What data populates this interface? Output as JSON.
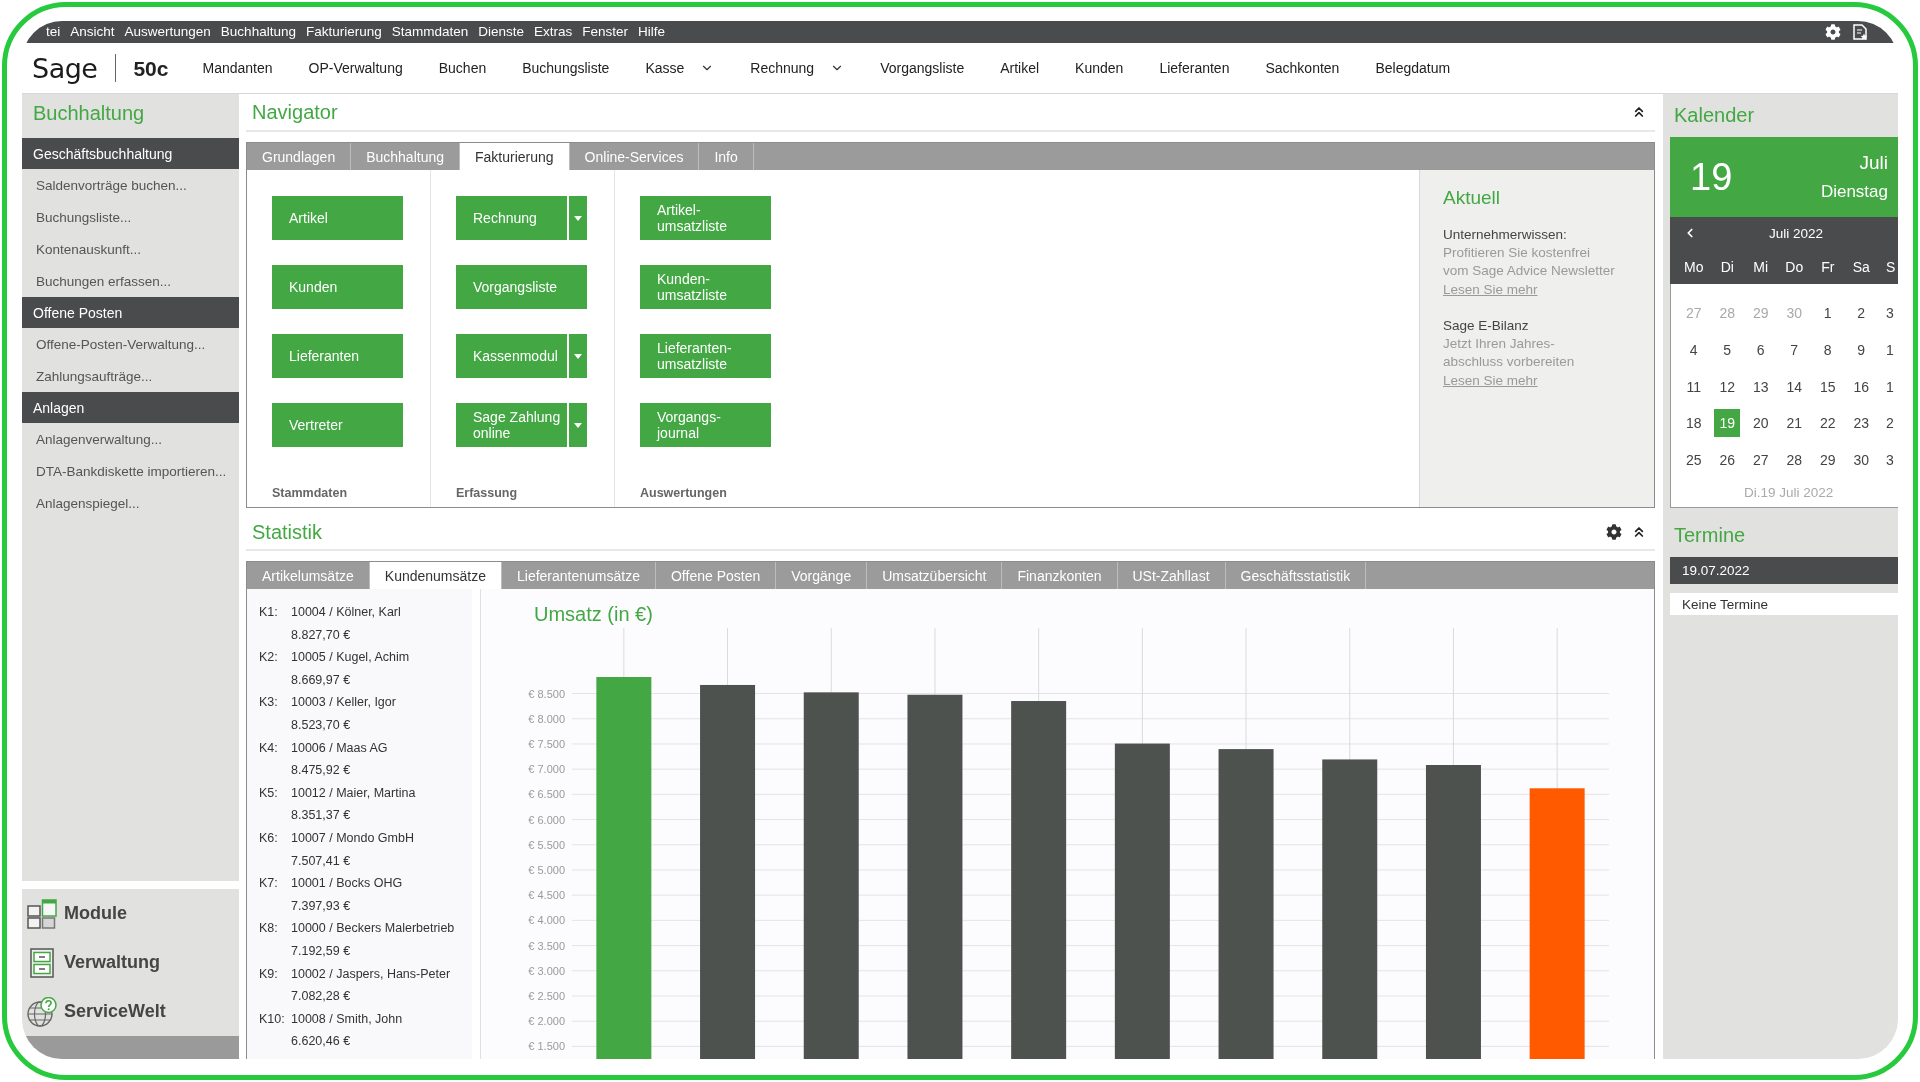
{
  "menu_bar": {
    "items": [
      "tei",
      "Ansicht",
      "Auswertungen",
      "Buchhaltung",
      "Fakturierung",
      "Stammdaten",
      "Dienste",
      "Extras",
      "Fenster",
      "Hilfe"
    ]
  },
  "toolbar": {
    "logo": "Sage",
    "edition": "50c",
    "items": [
      {
        "label": "Mandanten",
        "dropdown": false
      },
      {
        "label": "OP-Verwaltung",
        "dropdown": false
      },
      {
        "label": "Buchen",
        "dropdown": false
      },
      {
        "label": "Buchungsliste",
        "dropdown": false
      },
      {
        "label": "Kasse",
        "dropdown": true
      },
      {
        "label": "Rechnung",
        "dropdown": true
      },
      {
        "label": "Vorgangsliste",
        "dropdown": false
      },
      {
        "label": "Artikel",
        "dropdown": false
      },
      {
        "label": "Kunden",
        "dropdown": false
      },
      {
        "label": "Lieferanten",
        "dropdown": false
      },
      {
        "label": "Sachkonten",
        "dropdown": false
      },
      {
        "label": "Belegdatum",
        "dropdown": false
      }
    ]
  },
  "sidebar": {
    "title": "Buchhaltung",
    "groups": [
      {
        "label": "Geschäftsbuchhaltung",
        "items": [
          "Saldenvorträge buchen...",
          "Buchungsliste...",
          "Kontenauskunft...",
          "Buchungen erfassen..."
        ]
      },
      {
        "label": "Offene Posten",
        "items": [
          "Offene-Posten-Verwaltung...",
          "Zahlungsaufträge..."
        ]
      },
      {
        "label": "Anlagen",
        "items": [
          "Anlagenverwaltung...",
          "DTA-Bankdiskette importieren...",
          "Anlagenspiegel..."
        ]
      }
    ],
    "shortcuts": [
      {
        "label": "Module",
        "kind": "modules"
      },
      {
        "label": "Verwaltung",
        "kind": "administration"
      },
      {
        "label": "ServiceWelt",
        "kind": "service"
      }
    ]
  },
  "navigator": {
    "title": "Navigator",
    "tabs": [
      {
        "label": "Grundlagen",
        "selected": false
      },
      {
        "label": "Buchhaltung",
        "selected": false
      },
      {
        "label": "Fakturierung",
        "selected": true
      },
      {
        "label": "Online-Services",
        "selected": false
      },
      {
        "label": "Info",
        "selected": false
      }
    ],
    "columns": [
      {
        "label": "Stammdaten",
        "buttons": [
          {
            "label": "Artikel",
            "split": false
          },
          {
            "label": "Kunden",
            "split": false
          },
          {
            "label": "Lieferanten",
            "split": false
          },
          {
            "label": "Vertreter",
            "split": false
          }
        ]
      },
      {
        "label": "Erfassung",
        "buttons": [
          {
            "label": "Rechnung",
            "split": true
          },
          {
            "label": "Vorgangsliste",
            "split": false
          },
          {
            "label": "Kassenmodul",
            "split": true
          },
          {
            "label": "Sage Zahlung\nonline",
            "split": true
          }
        ]
      },
      {
        "label": "Auswertungen",
        "buttons": [
          {
            "label": "Artikel-\numsatzliste",
            "split": false
          },
          {
            "label": "Kunden-\numsatzliste",
            "split": false
          },
          {
            "label": "Lieferanten-\numsatzliste",
            "split": false
          },
          {
            "label": "Vorgangs-\njournal",
            "split": false
          }
        ]
      }
    ],
    "news": {
      "title": "Aktuell",
      "items": [
        {
          "heading": "Unternehmerwissen:",
          "text": "Profitieren Sie kostenfrei\nvom Sage Advice Newsletter",
          "link": "Lesen Sie mehr"
        },
        {
          "heading": "Sage E-Bilanz",
          "text": "Jetzt Ihren Jahres-\nabschluss vorbereiten",
          "link": "Lesen Sie mehr"
        }
      ]
    }
  },
  "statistik": {
    "title": "Statistik",
    "tabs": [
      {
        "label": "Artikelumsätze",
        "selected": false
      },
      {
        "label": "Kundenumsätze",
        "selected": true
      },
      {
        "label": "Lieferantenumsätze",
        "selected": false
      },
      {
        "label": "Offene Posten",
        "selected": false
      },
      {
        "label": "Vorgänge",
        "selected": false
      },
      {
        "label": "Umsatzübersicht",
        "selected": false
      },
      {
        "label": "Finanzkonten",
        "selected": false
      },
      {
        "label": "USt-Zahllast",
        "selected": false
      },
      {
        "label": "Geschäftsstatistik",
        "selected": false
      }
    ],
    "customers": [
      {
        "rank": "K1:",
        "name": "10004 / Kölner, Karl",
        "amount": "8.827,70 €"
      },
      {
        "rank": "K2:",
        "name": "10005 / Kugel, Achim",
        "amount": "8.669,97 €"
      },
      {
        "rank": "K3:",
        "name": "10003 / Keller, Igor",
        "amount": "8.523,70 €"
      },
      {
        "rank": "K4:",
        "name": "10006 / Maas AG",
        "amount": "8.475,92 €"
      },
      {
        "rank": "K5:",
        "name": "10012 / Maier, Martina",
        "amount": "8.351,37 €"
      },
      {
        "rank": "K6:",
        "name": "10007 / Mondo GmbH",
        "amount": "7.507,41 €"
      },
      {
        "rank": "K7:",
        "name": "10001 / Bocks OHG",
        "amount": "7.397,93 €"
      },
      {
        "rank": "K8:",
        "name": "10000 / Beckers Malerbetrieb",
        "amount": "7.192,59 €"
      },
      {
        "rank": "K9:",
        "name": "10002 / Jaspers, Hans-Peter",
        "amount": "7.082,28 €"
      },
      {
        "rank": "K10:",
        "name": "10008 / Smith, John",
        "amount": "6.620,46 €"
      }
    ],
    "chart_data": {
      "type": "bar",
      "title": "Umsatz (in €)",
      "values": [
        8827.7,
        8669.97,
        8523.7,
        8475.92,
        8351.37,
        7507.41,
        7397.93,
        7192.59,
        7082.28,
        6620.46
      ],
      "grid": true,
      "ylim": [
        1250,
        9800
      ],
      "yticks": [
        {
          "value": 1500,
          "label": "€ 1.500"
        },
        {
          "value": 2000,
          "label": "€ 2.000"
        },
        {
          "value": 2500,
          "label": "€ 2.500"
        },
        {
          "value": 3000,
          "label": "€ 3.000"
        },
        {
          "value": 3500,
          "label": "€ 3.500"
        },
        {
          "value": 4000,
          "label": "€ 4.000"
        },
        {
          "value": 4500,
          "label": "€ 4.500"
        },
        {
          "value": 5000,
          "label": "€ 5.000"
        },
        {
          "value": 5500,
          "label": "€ 5.500"
        },
        {
          "value": 6000,
          "label": "€ 6.000"
        },
        {
          "value": 6500,
          "label": "€ 6.500"
        },
        {
          "value": 7000,
          "label": "€ 7.000"
        },
        {
          "value": 7500,
          "label": "€ 7.500"
        },
        {
          "value": 8000,
          "label": "€ 8.000"
        },
        {
          "value": 8500,
          "label": "€ 8.500"
        }
      ]
    }
  },
  "calendar": {
    "title": "Kalender",
    "today": {
      "day": "19",
      "month": "Juli",
      "weekday": "Dienstag"
    },
    "month_label": "Juli 2022",
    "weekdays": [
      "Mo",
      "Di",
      "Mi",
      "Do",
      "Fr",
      "Sa",
      "S"
    ],
    "weeks": [
      [
        {
          "day": "27",
          "other_month": true,
          "selected": false
        },
        {
          "day": "28",
          "other_month": true,
          "selected": false
        },
        {
          "day": "29",
          "other_month": true,
          "selected": false
        },
        {
          "day": "30",
          "other_month": true,
          "selected": false
        },
        {
          "day": "1",
          "other_month": false,
          "selected": false
        },
        {
          "day": "2",
          "other_month": false,
          "selected": false
        },
        {
          "day": "3",
          "other_month": false,
          "selected": false
        }
      ],
      [
        {
          "day": "4",
          "other_month": false,
          "selected": false
        },
        {
          "day": "5",
          "other_month": false,
          "selected": false
        },
        {
          "day": "6",
          "other_month": false,
          "selected": false
        },
        {
          "day": "7",
          "other_month": false,
          "selected": false
        },
        {
          "day": "8",
          "other_month": false,
          "selected": false
        },
        {
          "day": "9",
          "other_month": false,
          "selected": false
        },
        {
          "day": "1",
          "other_month": false,
          "selected": false
        }
      ],
      [
        {
          "day": "11",
          "other_month": false,
          "selected": false
        },
        {
          "day": "12",
          "other_month": false,
          "selected": false
        },
        {
          "day": "13",
          "other_month": false,
          "selected": false
        },
        {
          "day": "14",
          "other_month": false,
          "selected": false
        },
        {
          "day": "15",
          "other_month": false,
          "selected": false
        },
        {
          "day": "16",
          "other_month": false,
          "selected": false
        },
        {
          "day": "1",
          "other_month": false,
          "selected": false
        }
      ],
      [
        {
          "day": "18",
          "other_month": false,
          "selected": false
        },
        {
          "day": "19",
          "other_month": false,
          "selected": true
        },
        {
          "day": "20",
          "other_month": false,
          "selected": false
        },
        {
          "day": "21",
          "other_month": false,
          "selected": false
        },
        {
          "day": "22",
          "other_month": false,
          "selected": false
        },
        {
          "day": "23",
          "other_month": false,
          "selected": false
        },
        {
          "day": "2",
          "other_month": false,
          "selected": false
        }
      ],
      [
        {
          "day": "25",
          "other_month": false,
          "selected": false
        },
        {
          "day": "26",
          "other_month": false,
          "selected": false
        },
        {
          "day": "27",
          "other_month": false,
          "selected": false
        },
        {
          "day": "28",
          "other_month": false,
          "selected": false
        },
        {
          "day": "29",
          "other_month": false,
          "selected": false
        },
        {
          "day": "30",
          "other_month": false,
          "selected": false
        },
        {
          "day": "3",
          "other_month": false,
          "selected": false
        }
      ]
    ],
    "footer": "Di.19 Juli 2022"
  },
  "appointments": {
    "title": "Termine",
    "date": "19.07.2022",
    "empty_message": "Keine Termine"
  }
}
